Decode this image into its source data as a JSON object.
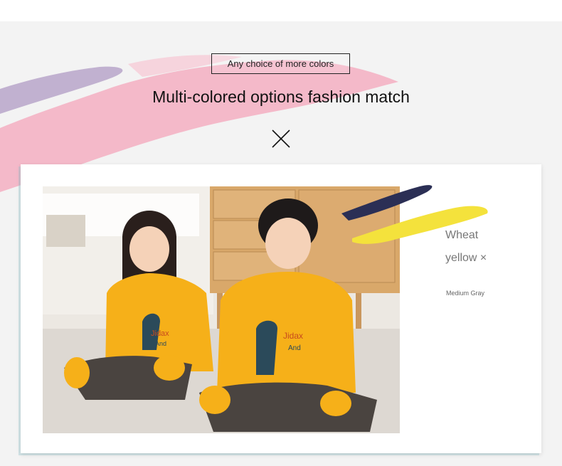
{
  "banner": {
    "tag": "Any choice of more colors",
    "headline": "Multi-colored options fashion match"
  },
  "product": {
    "color_line1": "Wheat",
    "color_line2": "yellow ×",
    "color_sub": "Medium Gray",
    "jersey_print_left": "Jidax",
    "jersey_print_left2": "And",
    "jersey_print_right": "Jidax",
    "jersey_print_right2": "And"
  },
  "colors": {
    "shirt": "#f6b019",
    "pants": "#4a4440",
    "brush_pink": "#f4b3c4",
    "brush_lilac": "#b7a5c9",
    "brush_navy": "#2b2f55",
    "brush_yellow": "#f4e23c"
  }
}
